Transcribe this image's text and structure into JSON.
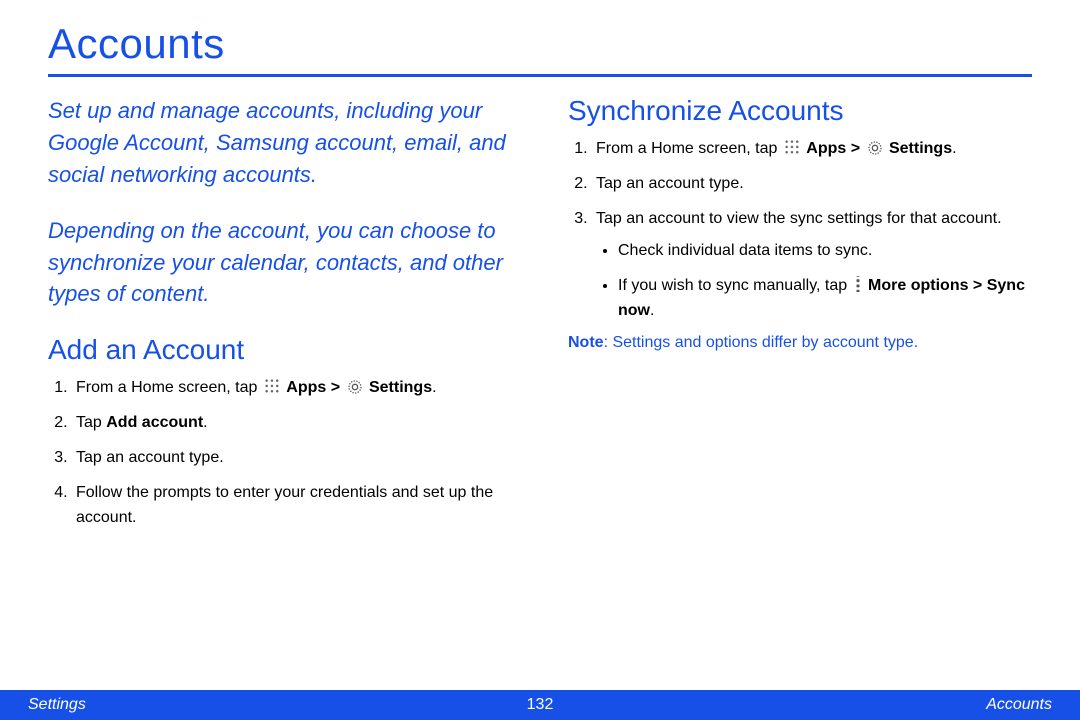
{
  "title": "Accounts",
  "intro1": "Set up and manage accounts, including your Google Account, Samsung account, email, and social networking accounts.",
  "intro2": "Depending on the account, you can choose to synchronize your calendar, contacts, and other types of content.",
  "left": {
    "heading": "Add an Account",
    "s1a": "From a Home screen, tap ",
    "s1b": " Apps > ",
    "s1c": " Settings",
    "s1d": ".",
    "s2a": "Tap ",
    "s2b": "Add account",
    "s2c": ".",
    "s3": "Tap an account type.",
    "s4": "Follow the prompts to enter your credentials and set up the account."
  },
  "right": {
    "heading": "Synchronize Accounts",
    "s1a": "From a Home screen, tap ",
    "s1b": " Apps > ",
    "s1c": " Settings",
    "s1d": ".",
    "s2": "Tap an account type.",
    "s3": "Tap an account to view the sync settings for that account.",
    "b1": "Check individual data items to sync.",
    "b2a": "If you wish to sync manually, tap ",
    "b2b": " More options > Sync now",
    "b2c": ".",
    "noteLabel": "Note",
    "noteText": ": Settings and options differ by account type."
  },
  "footer": {
    "left": "Settings",
    "center": "132",
    "right": "Accounts"
  }
}
